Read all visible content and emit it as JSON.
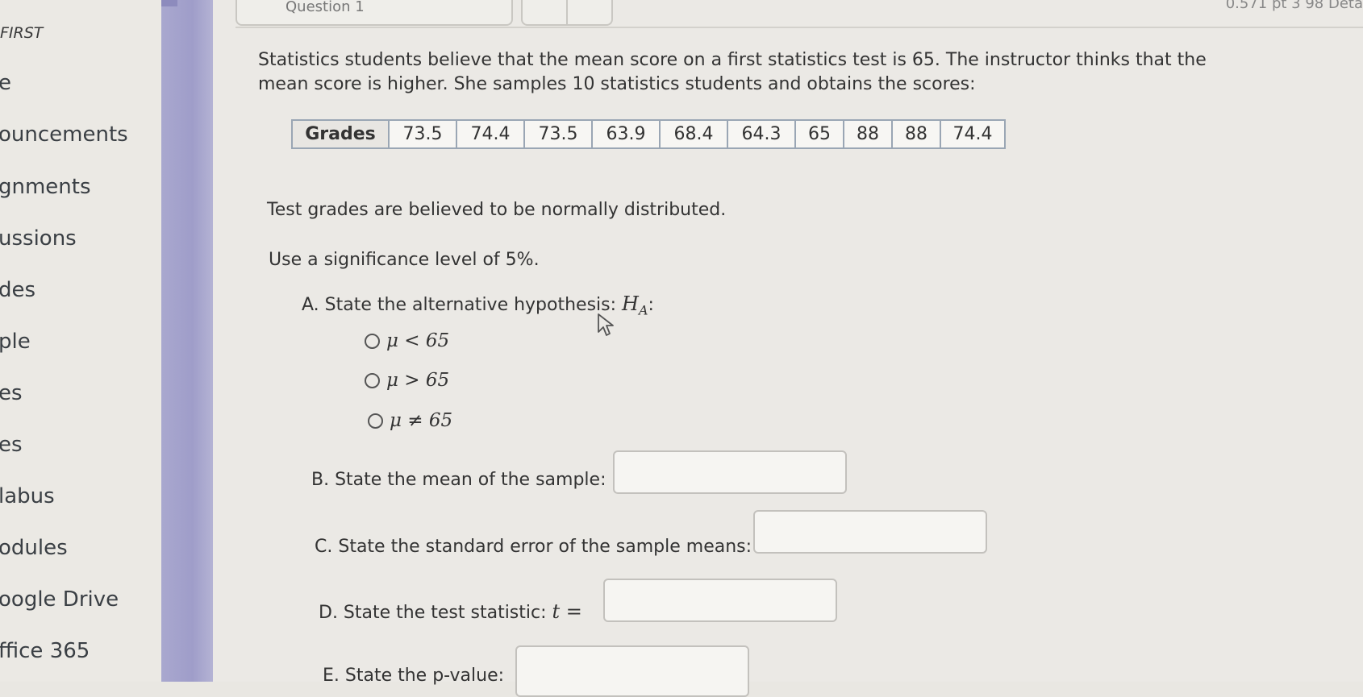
{
  "nav": {
    "header": "FIRST",
    "items": [
      "e",
      "ouncements",
      "gnments",
      "ussions",
      "des",
      "ple",
      "es",
      "es",
      "labus",
      "odules",
      "oogle Drive",
      "ffice 365"
    ]
  },
  "topbar": {
    "question_tab": "Question 1",
    "right_text": "0.571 pt   3   98   Deta"
  },
  "problem": {
    "intro": "Statistics students believe that the mean score on a first statistics test is 65. The instructor thinks that the mean score is higher. She samples 10 statistics students and obtains the scores:",
    "table_header": "Grades",
    "grades": [
      "73.5",
      "74.4",
      "73.5",
      "63.9",
      "68.4",
      "64.3",
      "65",
      "88",
      "88",
      "74.4"
    ],
    "normal_note": "Test grades are believed to be normally distributed.",
    "significance": "Use a significance level of 5%.",
    "part_a": "A. State the alternative hypothesis:",
    "part_a_symbol": "H",
    "part_a_sub": "A",
    "part_a_colon": ":",
    "options": [
      "μ < 65",
      "μ > 65",
      "μ ≠ 65"
    ],
    "part_b": "B. State the mean of the sample:",
    "part_c": "C. State the standard error of the sample means:",
    "part_d": "D. State the test statistic:",
    "part_d_math": "t =",
    "part_e": "E. State the p-value:"
  }
}
